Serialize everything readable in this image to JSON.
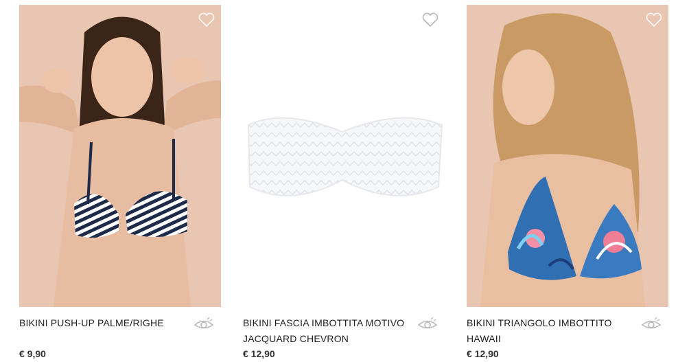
{
  "products": [
    {
      "name": "BIKINI PUSH-UP PALME/RIGHE",
      "price": "€ 9,90"
    },
    {
      "name": "BIKINI FASCIA IMBOTTITA MOTIVO JACQUARD CHEVRON",
      "price": "€ 12,90"
    },
    {
      "name": "BIKINI TRIANGOLO IMBOTTITO HAWAII",
      "price": "€ 12,90"
    }
  ],
  "icons": {
    "favorite": "heart-outline-icon",
    "quick_view": "eye-icon"
  },
  "colors": {
    "background": "#ffffff",
    "model_backdrop": "#e9c6b1",
    "text": "#222222",
    "icon": "#b8b8b8",
    "stripe_navy": "#1e2a4a"
  }
}
